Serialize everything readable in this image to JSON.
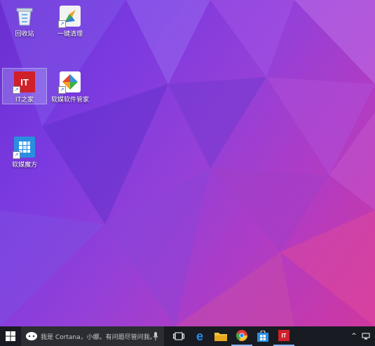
{
  "desktop": {
    "icons": [
      {
        "label": "回收站",
        "icon": "recycle-bin-icon"
      },
      {
        "label": "一键清理",
        "icon": "cleanup-icon"
      },
      {
        "label": "IT之家",
        "icon": "ithome-icon",
        "glyph": "IT",
        "selected": true
      },
      {
        "label": "软媒软件管家",
        "icon": "software-manager-icon"
      },
      {
        "label": "软媒魔方",
        "icon": "cube-icon"
      }
    ]
  },
  "taskbar": {
    "start_icon": "windows-logo-icon",
    "cortana_placeholder": "我是 Cortana，小娜。有问题尽管问我。",
    "mic_icon": "microphone-icon",
    "task_view_icon": "task-view-icon",
    "pinned": [
      {
        "name": "edge",
        "icon": "edge-icon",
        "glyph": "e"
      },
      {
        "name": "file-explorer",
        "icon": "folder-icon"
      },
      {
        "name": "chrome",
        "icon": "chrome-icon"
      },
      {
        "name": "store",
        "icon": "store-icon"
      },
      {
        "name": "ithome",
        "icon": "ithome-icon",
        "glyph": "IT"
      }
    ],
    "tray_chevron": "^",
    "tray_icon": "network-icon"
  },
  "colors": {
    "ithome_red": "#d0202a",
    "edge_blue": "#1f8ef1",
    "taskbar": "#191b22"
  }
}
